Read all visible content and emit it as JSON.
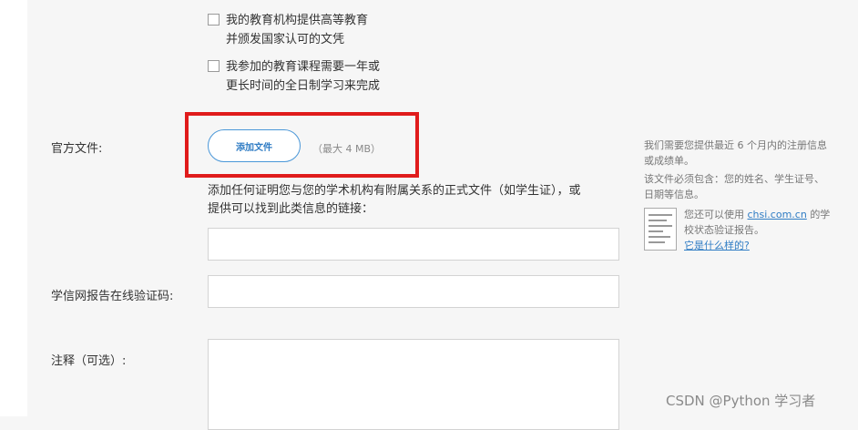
{
  "checkboxes": [
    {
      "line1": "我的教育机构提供高等教育",
      "line2": "并颁发国家认可的文凭"
    },
    {
      "line1": "我参加的教育课程需要一年或",
      "line2": "更长时间的全日制学习来完成"
    }
  ],
  "official_docs": {
    "label": "官方文件:",
    "add_button": "添加文件",
    "max_size": "（最大 4 MB）",
    "help_text": "添加任何证明您与您的学术机构有附属关系的正式文件（如学生证），或提供可以找到此类信息的链接："
  },
  "verification": {
    "label": "学信网报告在线验证码:"
  },
  "notes": {
    "label": "注释（可选）:"
  },
  "sidebar": {
    "note1": "我们需要您提供最近 6 个月内的注册信息或成绩单。",
    "note2": "该文件必须包含：您的姓名、学生证号、日期等信息。",
    "chsi_prefix": "您还可以使用",
    "chsi_link": "chsi.com.cn",
    "chsi_suffix": "的学校状态验证报告。",
    "example_link": "它是什么样的?"
  },
  "watermark": "CSDN @Python 学习者",
  "colors": {
    "highlight": "#e01b1b",
    "accent": "#2f7cc4",
    "background": "#f6f6f6"
  }
}
